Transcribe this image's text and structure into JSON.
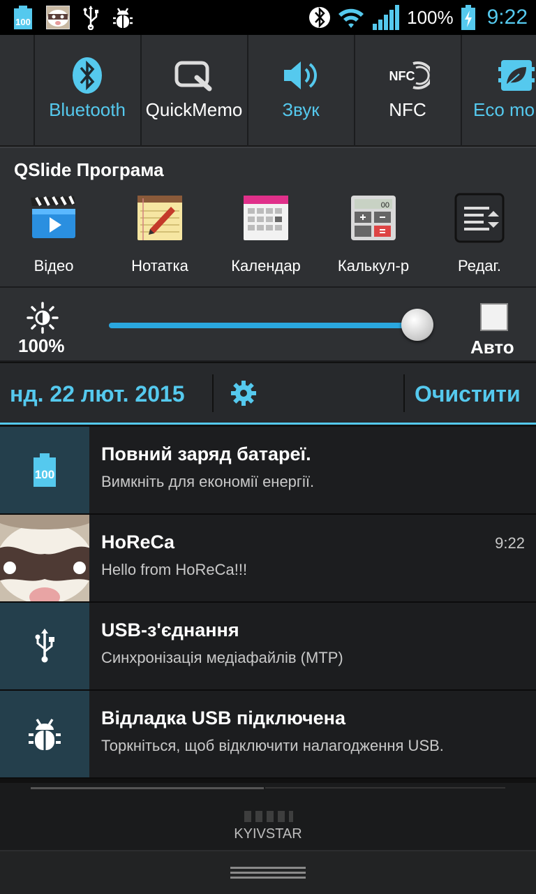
{
  "status_bar": {
    "battery_icon_text": "100",
    "battery_percent": "100%",
    "time": "9:22",
    "icons": [
      "battery-full-icon",
      "horeca-app-icon",
      "usb-icon",
      "debug-bug-icon",
      "bluetooth-icon",
      "wifi-icon",
      "signal-icon",
      "charging-battery-icon"
    ]
  },
  "toggles": [
    {
      "label": "Bluetooth",
      "icon": "bluetooth-icon",
      "active": true
    },
    {
      "label": "QuickMemo",
      "icon": "quickmemo-icon",
      "active": false
    },
    {
      "label": "Звук",
      "icon": "sound-icon",
      "active": true
    },
    {
      "label": "NFC",
      "icon": "nfc-icon",
      "active": false
    },
    {
      "label": "Eco mo",
      "icon": "eco-mode-icon",
      "active": true
    }
  ],
  "qslide": {
    "title": "QSlide Програма",
    "apps": [
      {
        "label": "Відео",
        "icon": "video-icon"
      },
      {
        "label": "Нотатка",
        "icon": "notepad-icon"
      },
      {
        "label": "Календар",
        "icon": "calendar-icon"
      },
      {
        "label": "Калькул-р",
        "icon": "calculator-icon"
      },
      {
        "label": "Редаг.",
        "icon": "edit-icon"
      }
    ],
    "calculator_display": "00"
  },
  "brightness": {
    "percent_label": "100%",
    "level": 0.96,
    "auto_label": "Авто",
    "auto_checked": false
  },
  "date_row": {
    "date": "нд. 22 лют. 2015",
    "clear_label": "Очистити"
  },
  "notifications": [
    {
      "title": "Повний заряд батареї.",
      "text": "Вимкніть для економії енергії.",
      "time": "",
      "icon": "battery-full-icon",
      "icon_text": "100"
    },
    {
      "title": "HoReCa",
      "text": "Hello from HoReCa!!!",
      "time": "9:22",
      "icon": "horeca-avatar-icon"
    },
    {
      "title": "USB-з'єднання",
      "text": "Синхронізація медіафайлів (MTP)",
      "time": "",
      "icon": "usb-icon"
    },
    {
      "title": "Відладка USB підключена",
      "text": "Торкніться, щоб відключити налагодження USB.",
      "time": "",
      "icon": "debug-bug-icon"
    }
  ],
  "carrier": "KYIVSTAR",
  "colors": {
    "accent": "#55c9ee",
    "panel": "#2e3033",
    "notif_icon_bg": "#243f4c"
  }
}
